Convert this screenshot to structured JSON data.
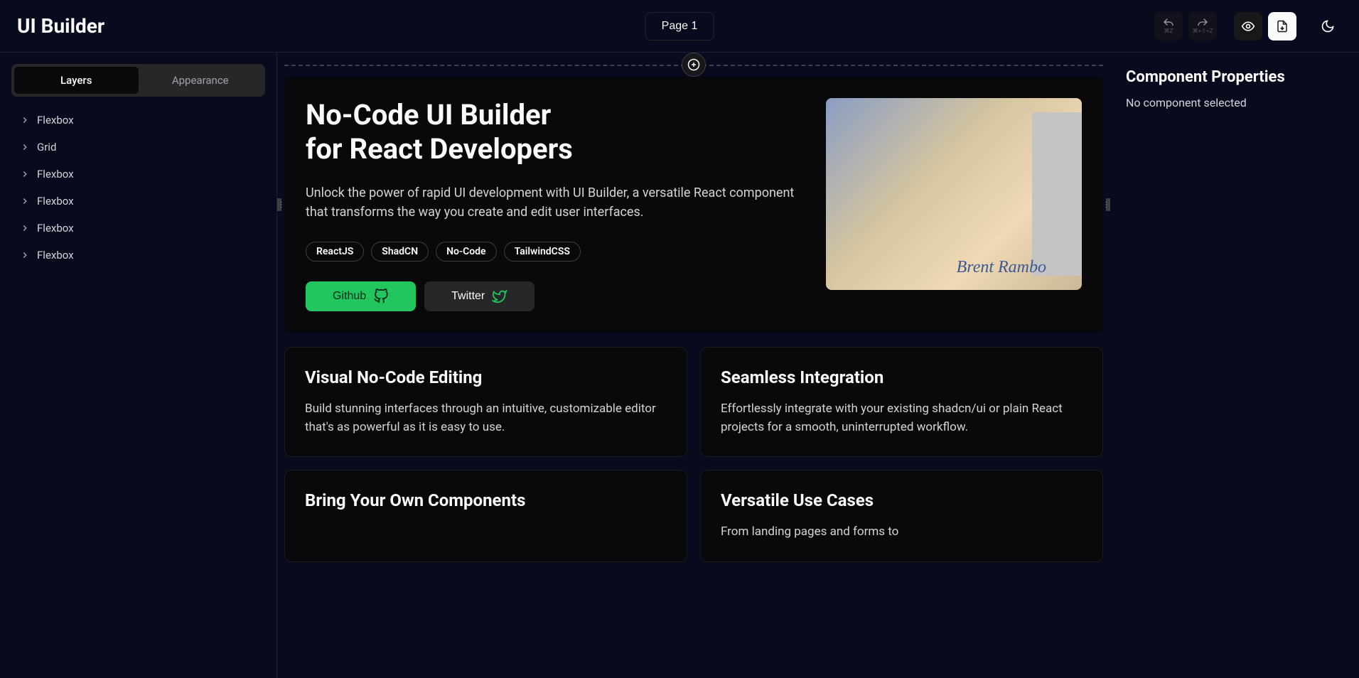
{
  "header": {
    "app_title": "UI Builder",
    "page_chip": "Page 1",
    "undo_kbd": "⌘Z",
    "redo_kbd": "⌘+⇧+Z"
  },
  "left_panel": {
    "tabs": {
      "layers": "Layers",
      "appearance": "Appearance"
    },
    "tree": [
      {
        "label": "Flexbox"
      },
      {
        "label": "Grid"
      },
      {
        "label": "Flexbox"
      },
      {
        "label": "Flexbox"
      },
      {
        "label": "Flexbox"
      },
      {
        "label": "Flexbox"
      }
    ]
  },
  "canvas": {
    "hero": {
      "title_l1": "No-Code UI Builder",
      "title_l2": "for React Developers",
      "desc": "Unlock the power of rapid UI development with UI Builder, a versatile React component that transforms the way you create and edit user interfaces.",
      "badges": [
        "ReactJS",
        "ShadCN",
        "No-Code",
        "TailwindCS​S"
      ],
      "btn_primary": "Github",
      "btn_secondary": "Twitter",
      "img_signature": "Brent Rambo"
    },
    "cards": [
      {
        "title": "Visual No-Code Editing",
        "body": "Build stunning interfaces through an intuitive, customizable editor that's as powerful as it is easy to use."
      },
      {
        "title": "Seamless Integration",
        "body": "Effortlessly integrate with your existing shadcn/ui or plain React projects for a smooth, uninterrupted workflow."
      },
      {
        "title": "Bring Your Own Components",
        "body": ""
      },
      {
        "title": "Versatile Use Cases",
        "body": "From landing pages and forms to"
      }
    ]
  },
  "right_panel": {
    "title": "Component Properties",
    "empty": "No component selected"
  }
}
